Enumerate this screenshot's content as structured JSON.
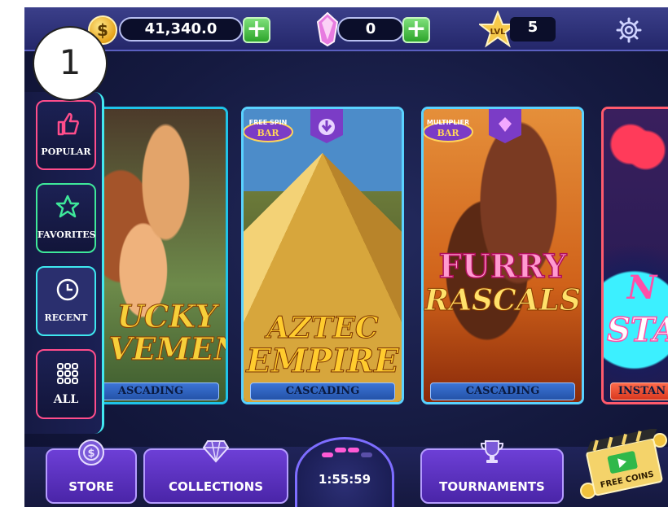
{
  "step_badge": "1",
  "currency": {
    "coins_icon": "$",
    "coins": "41,340.0",
    "coins_add": "+",
    "gems": "0",
    "gems_add": "+",
    "level_label": "LVL",
    "level": "5"
  },
  "sidebar": {
    "items": [
      {
        "label": "POPULAR",
        "icon": "thumbs-up-icon",
        "color": "#ff4d8b"
      },
      {
        "label": "FAVORITES",
        "icon": "star-outline-icon",
        "color": "#3ee89a"
      },
      {
        "label": "RECENT",
        "icon": "clock-icon",
        "color": "#3ee8ef"
      },
      {
        "label": "ALL",
        "icon": "grid-icon",
        "color": "#ff4d8b"
      }
    ]
  },
  "games": [
    {
      "title_line1": "UCKY",
      "title_line2": "VEMEN",
      "tag": "ASCADING",
      "border": "#1fc3e8"
    },
    {
      "title_line1": "AZTEC",
      "title_line2": "EMPIRE",
      "tag": "CASCADING",
      "badge": "FREE SPIN BAR",
      "border": "#5ad2ff"
    },
    {
      "title_line1": "FURRY",
      "title_line2": "RASCALS",
      "tag": "CASCADING",
      "badge": "MULTIPLIER BAR",
      "border": "#5ad2ff"
    },
    {
      "title_line1": "N",
      "title_line2": "STA",
      "tag": "INSTAN",
      "border": "#ff5a6c"
    }
  ],
  "bottom_nav": {
    "store": "STORE",
    "collections": "COLLECTIONS",
    "timer": "1:55:59",
    "tournaments": "TOURNAMENTS",
    "free_coins": "FREE COINS"
  },
  "colors": {
    "accent_cyan": "#42e8f0",
    "nav_purple": "#5b30c0",
    "plus_green": "#2da52b",
    "tag_blue": "#3c74d6"
  }
}
